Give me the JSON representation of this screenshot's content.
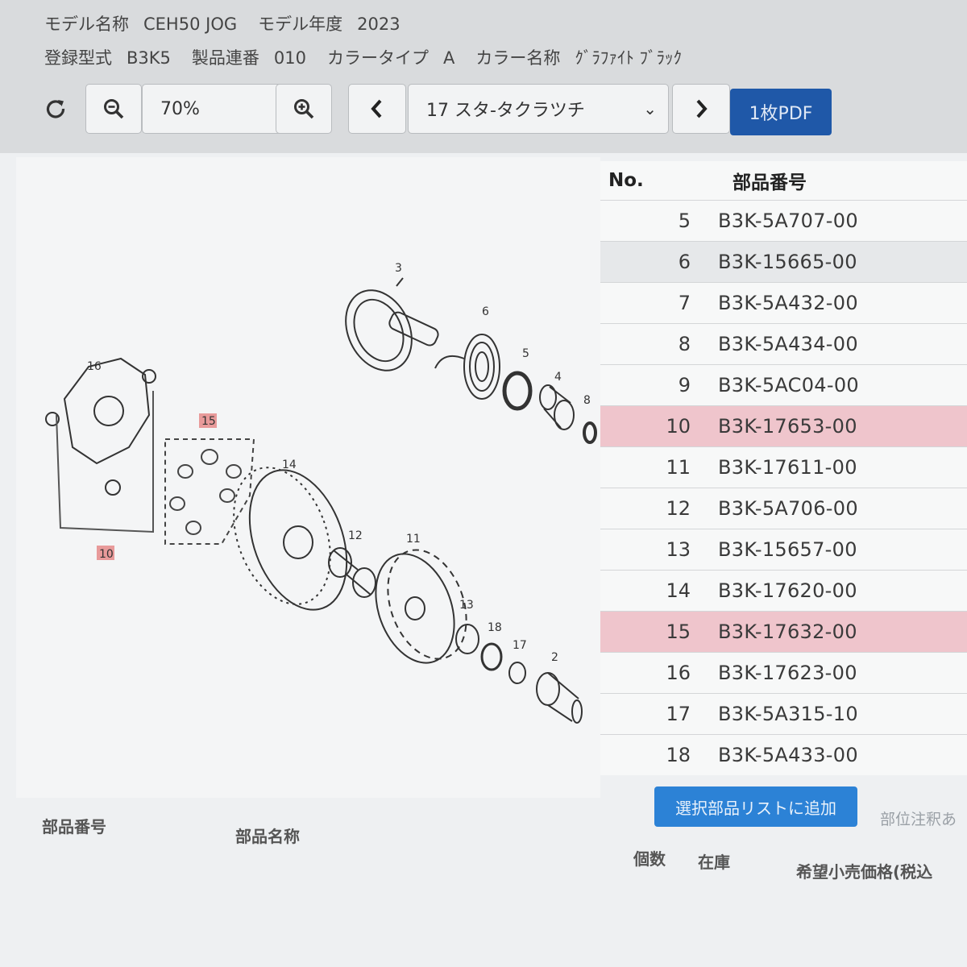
{
  "header": {
    "model_name_label": "モデル名称",
    "model_name": "CEH50 JOG",
    "model_year_label": "モデル年度",
    "model_year": "2023",
    "reg_type_label": "登録型式",
    "reg_type": "B3K5",
    "serial_label": "製品連番",
    "serial": "010",
    "color_type_label": "カラータイプ",
    "color_type": "A",
    "color_name_label": "カラー名称",
    "color_name": "ｸﾞﾗﾌｧｲﾄ ﾌﾞﾗｯｸ"
  },
  "toolbar": {
    "refresh_icon": "refresh-icon",
    "zoom_out_icon": "zoom-out-icon",
    "zoom_level": "70%",
    "zoom_in_icon": "zoom-in-icon",
    "prev_icon": "chevron-left-icon",
    "section": "17 スタ-タクラツチ",
    "next_icon": "chevron-right-icon",
    "pdf_label": "1枚PDF"
  },
  "diagram": {
    "callouts": [
      "3",
      "6",
      "5",
      "4",
      "8",
      "16",
      "15",
      "14",
      "12",
      "11",
      "10",
      "13",
      "18",
      "17",
      "2"
    ],
    "highlighted": [
      "15",
      "10"
    ],
    "highlight_color": "#e89a9a"
  },
  "parts_table": {
    "header_no": "No.",
    "header_part": "部品番号",
    "rows": [
      {
        "no": "5",
        "part": "B3K-5A707-00"
      },
      {
        "no": "6",
        "part": "B3K-15665-00"
      },
      {
        "no": "7",
        "part": "B3K-5A432-00"
      },
      {
        "no": "8",
        "part": "B3K-5A434-00"
      },
      {
        "no": "9",
        "part": "B3K-5AC04-00"
      },
      {
        "no": "10",
        "part": "B3K-17653-00"
      },
      {
        "no": "11",
        "part": "B3K-17611-00"
      },
      {
        "no": "12",
        "part": "B3K-5A706-00"
      },
      {
        "no": "13",
        "part": "B3K-15657-00"
      },
      {
        "no": "14",
        "part": "B3K-17620-00"
      },
      {
        "no": "15",
        "part": "B3K-17632-00"
      },
      {
        "no": "16",
        "part": "B3K-17623-00"
      },
      {
        "no": "17",
        "part": "B3K-5A315-10"
      },
      {
        "no": "18",
        "part": "B3K-5A433-00"
      }
    ],
    "highlight_color": "#efc5cc"
  },
  "bottom": {
    "add_button": "選択部品リストに追加",
    "note": "部位注釈あ",
    "col_part_number": "部品番号",
    "col_part_name": "部品名称",
    "col_qty": "個数",
    "col_stock": "在庫",
    "col_price": "希望小売価格(税込"
  },
  "colors": {
    "pdf_button": "#1f58a8",
    "add_button": "#2c82d6",
    "row_highlight": "#efc5cc"
  }
}
